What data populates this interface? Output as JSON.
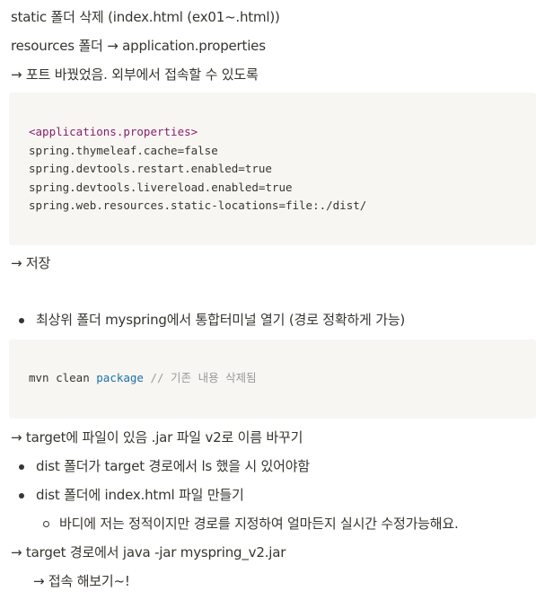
{
  "lines": {
    "l1": "static 폴더 삭제 (index.html (ex01~.html))",
    "l2": "resources 폴더 → application.properties",
    "l3": "→ 포트 바꿨었음. 외부에서 접속할 수 있도록",
    "save": "→ 저장",
    "target_jar": "→ target에 파일이 있음 .jar 파일 v2로 이름 바꾸기",
    "run": "→ target 경로에서 java -jar myspring_v2.jar",
    "connect": "→ 접속 해보기~!"
  },
  "code1": {
    "header": "<applications.properties>",
    "lines": [
      "spring.thymeleaf.cache=false",
      "spring.devtools.restart.enabled=true",
      "spring.devtools.livereload.enabled=true",
      "spring.web.resources.static-locations=file:./dist/"
    ]
  },
  "bullet1": "최상위 폴더 myspring에서 통합터미널 열기 (경로 정확하게 가능)",
  "code2": {
    "cmd": "mvn clean ",
    "keyword": "package",
    "comment": " // 기존 내용 삭제됨"
  },
  "bullets2": [
    "dist 폴더가 target 경로에서 ls 했을 시 있어야함",
    "dist 폴더에 index.html 파일 만들기"
  ],
  "sub_bullet": "바디에 저는 정적이지만 경로를 지정하여 얼마든지 실시간 수정가능해요."
}
